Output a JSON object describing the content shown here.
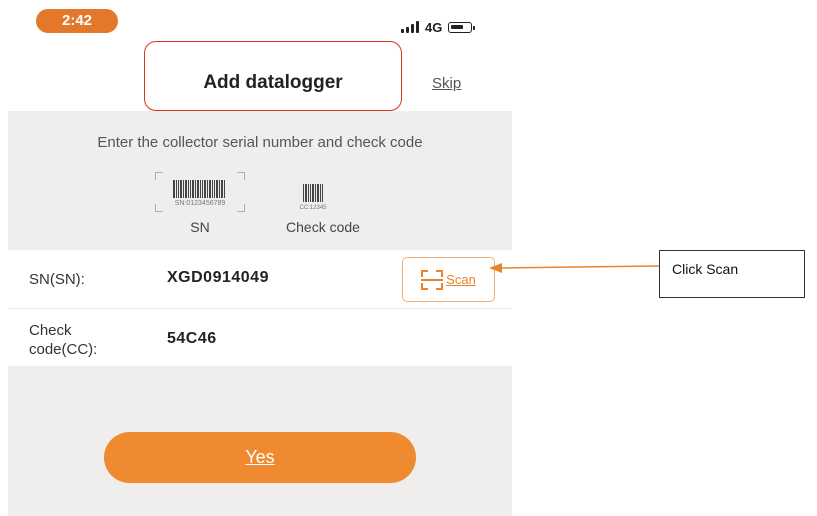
{
  "status_bar": {
    "time": "2:42",
    "network": "4G"
  },
  "header": {
    "title": "Add datalogger",
    "skip_label": "Skip"
  },
  "info": {
    "instruction": "Enter the collector serial number and check code",
    "sn_sample_code": "SN:0123456789",
    "cc_sample_code": "CC:12345",
    "sn_caption": "SN",
    "cc_caption": "Check code"
  },
  "form": {
    "sn_label": "SN(SN):",
    "sn_value": "XGD0914049",
    "scan_label": "Scan",
    "cc_label_line1": "Check",
    "cc_label_line2": "code(CC):",
    "cc_value": "54C46"
  },
  "confirm_label": "Yes",
  "annotation": {
    "text": "Click Scan"
  },
  "colors": {
    "accent": "#f08a30",
    "time_pill": "#e3782a",
    "highlight_box": "#e0301e",
    "background_gray": "#efeeec"
  }
}
